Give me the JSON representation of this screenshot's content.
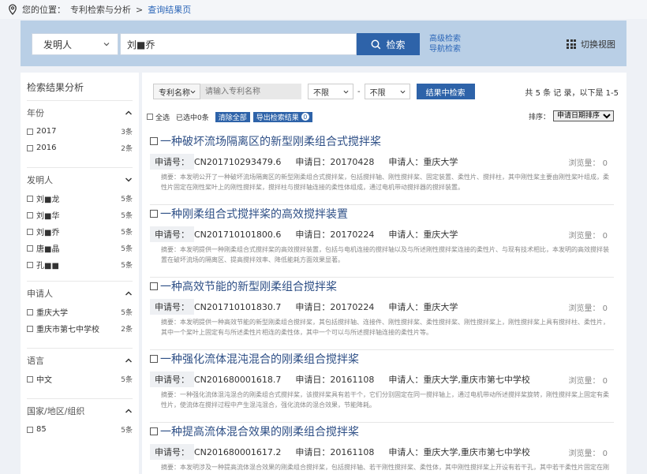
{
  "breadcrumb": {
    "prefix": "您的位置：",
    "section": "专利检索与分析",
    "sep": " >",
    "current": "查询结果页"
  },
  "search": {
    "field_label": "发明人",
    "query_value": "刘■乔",
    "button_label": "检索",
    "advanced_label": "高级检索",
    "nav_label": "导航检索",
    "switch_view_label": "切换视图"
  },
  "sidebar": {
    "title": "检索结果分析",
    "groups": [
      {
        "heading": "年份",
        "expanded": true,
        "items": [
          {
            "name": "2017",
            "count": "3条"
          },
          {
            "name": "2016",
            "count": "2条"
          }
        ]
      },
      {
        "heading": "发明人",
        "expanded": false,
        "items": [
          {
            "name": "刘■龙",
            "count": "5条"
          },
          {
            "name": "刘■华",
            "count": "5条"
          },
          {
            "name": "刘■乔",
            "count": "5条"
          },
          {
            "name": "唐■晶",
            "count": "5条"
          },
          {
            "name": "孔■■",
            "count": "5条"
          }
        ]
      },
      {
        "heading": "申请人",
        "expanded": true,
        "items": [
          {
            "name": "重庆大学",
            "count": "5条"
          },
          {
            "name": "重庆市第七中学校",
            "count": "2条"
          }
        ]
      },
      {
        "heading": "语言",
        "expanded": true,
        "items": [
          {
            "name": "中文",
            "count": "5条"
          }
        ]
      },
      {
        "heading": "国家/地区/组织",
        "expanded": true,
        "items": [
          {
            "name": "85",
            "count": "5条"
          }
        ]
      }
    ]
  },
  "filter": {
    "field_label": "专利名称",
    "input_placeholder": "请输入专利名称",
    "from_label": "不限",
    "dash": "-",
    "to_label": "不限",
    "button_label": "结果中检索",
    "total_text": "共 5 条 记 录，以下是 1-5"
  },
  "toolbar": {
    "select_all": "全选",
    "selected_text": "已选中0条",
    "clear_label": "清除全部",
    "export_label": "导出检索结果",
    "export_count": "0",
    "sort_label": "排序：",
    "sort_value": "申请日期排序"
  },
  "labels": {
    "app_no": "申请号：",
    "app_date": "申请日：",
    "applicant": "申请人："
  },
  "results": [
    {
      "title": "一种破坏流场隔离区的新型刚柔组合式搅拌桨",
      "app_no": "CN201710293479.6",
      "app_date": "20170428",
      "applicant": "重庆大学",
      "views": "浏览量： 0",
      "abstract": "摘要：本发明公开了一种破坏流场隔离区的新型刚柔组合式搅拌桨，包括搅拌轴、刚性搅拌桨、固定装置、柔性片、搅拌柱，其中刚性桨主要由刚性桨叶组成，柔性片固定在刚性桨叶上的刚性搅拌桨，搅拌柱与搅拌轴连接的柔性体组成，通过电机带动搅拌器的搅拌装置。"
    },
    {
      "title": "一种刚柔组合式搅拌桨的高效搅拌装置",
      "app_no": "CN201710101800.6",
      "app_date": "20170224",
      "applicant": "重庆大学",
      "views": "浏览量： 0",
      "abstract": "摘要：本发明提供一种刚柔组合式搅拌桨的高效搅拌装置，包括与电机连接的搅拌轴以及与所述刚性搅拌桨连接的柔性片、与现有技术相比，本发明的高效搅拌装置在破坏流场的隔离区、提高搅拌效率、降低能耗方面效果显著。"
    },
    {
      "title": "一种高效节能的新型刚柔组合搅拌桨",
      "app_no": "CN201710101830.7",
      "app_date": "20170224",
      "applicant": "重庆大学",
      "views": "浏览量： 0",
      "abstract": "摘要：本发明提供一种高效节能的新型刚柔组合搅拌桨，其包括搅拌轴、连接件、刚性搅拌桨、柔性搅拌桨、刚性搅拌桨上，刚性搅拌桨上具有搅拌柱、柔性片，其中一个桨叶上固定有与所述柔性片相连的柔性体，其中一个可以与所述搅拌轴连接的柔性片等。"
    },
    {
      "title": "一种强化流体混沌混合的刚柔组合搅拌桨",
      "app_no": "CN201680001618.7",
      "app_date": "20161108",
      "applicant": "重庆大学,重庆市第七中学校",
      "views": "浏览量： 0",
      "abstract": "摘要：一种强化流体混沌混合的刚柔组合式搅拌桨，该搅拌桨具有若干个，它们分别固定在同一搅拌轴上，通过电机带动所述搅拌桨旋转，刚性搅拌桨上固定有柔性片，使流体在搅拌过程中产生混沌混合，强化流体的混合效果，节能降耗。"
    },
    {
      "title": "一种提高流体混合效果的刚柔组合搅拌桨",
      "app_no": "CN201680001617.2",
      "app_date": "20161108",
      "applicant": "重庆大学,重庆市第七中学校",
      "views": "浏览量： 0",
      "abstract": "摘要：本发明涉及一种提高流体混合效果的刚柔组合搅拌桨，包括搅拌轴、若干刚性搅拌桨、柔性体，其中刚性搅拌桨上开设有若干孔，其中若干柔性片固定在刚性桨上的搅拌装置。"
    }
  ]
}
